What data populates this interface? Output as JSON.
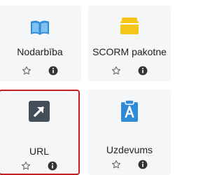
{
  "colors": {
    "book": "#2d8bd8",
    "package": "#f5c518",
    "url": "#444e58",
    "assign": "#2d8bd8",
    "selected_border": "#c21f25"
  },
  "tiles": [
    {
      "label": "Nodarbība",
      "icon": "book-icon"
    },
    {
      "label": "SCORM pakotne",
      "icon": "package-icon"
    },
    {
      "label": "URL",
      "icon": "link-arrow-icon",
      "selected": true
    },
    {
      "label": "Uzdevums",
      "icon": "assignment-icon"
    }
  ]
}
